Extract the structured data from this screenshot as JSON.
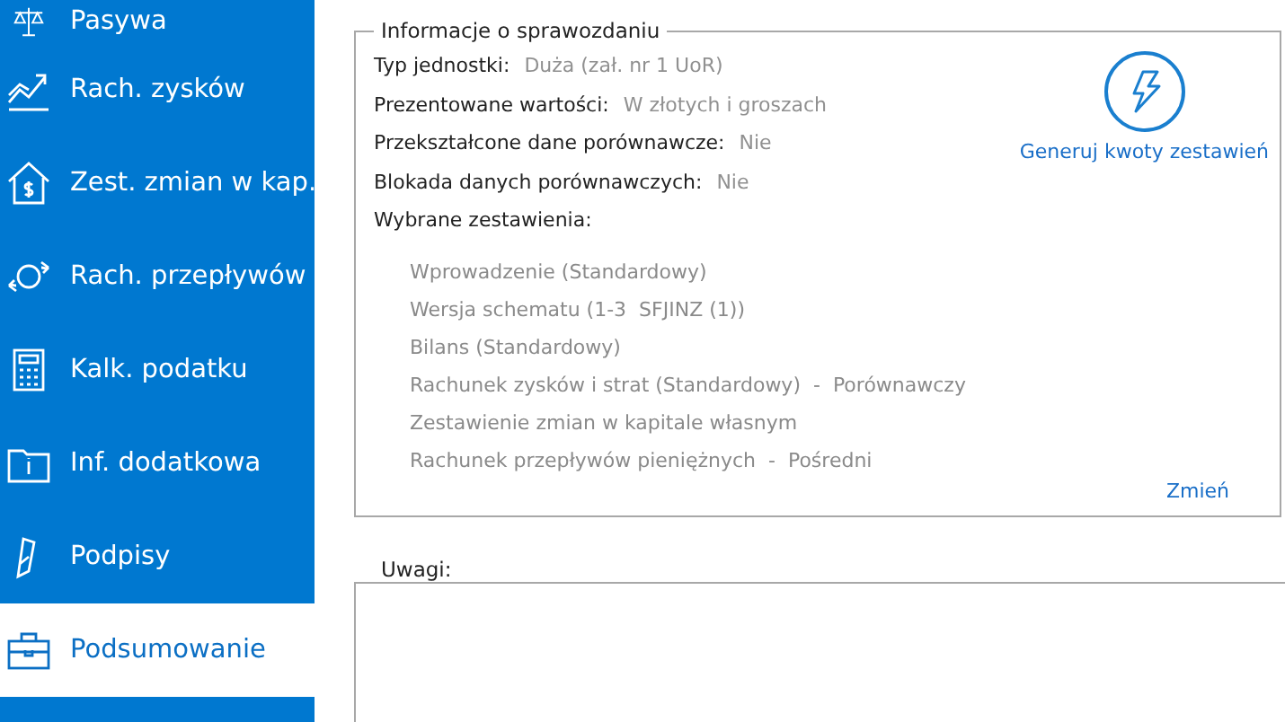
{
  "sidebar": {
    "items": [
      {
        "label": "Pasywa",
        "kind": "scale",
        "selected": false
      },
      {
        "label": "Rach. zysków",
        "kind": "chart",
        "selected": false
      },
      {
        "label": "Zest. zmian w kap.",
        "kind": "house",
        "selected": false
      },
      {
        "label": "Rach. przepływów",
        "kind": "flow",
        "selected": false
      },
      {
        "label": "Kalk. podatku",
        "kind": "calc",
        "selected": false
      },
      {
        "label": "Inf. dodatkowa",
        "kind": "folder",
        "selected": false
      },
      {
        "label": "Podpisy",
        "kind": "pen",
        "selected": false
      },
      {
        "label": "Podsumowanie",
        "kind": "case",
        "selected": true
      }
    ]
  },
  "report_info": {
    "title": "Informacje o sprawozdaniu",
    "fields": [
      {
        "label": "Typ jednostki:",
        "value": "Duża (zał. nr 1 UoR)"
      },
      {
        "label": "Prezentowane wartości:",
        "value": "W złotych i groszach"
      },
      {
        "label": "Przekształcone dane porównawcze:",
        "value": "Nie"
      },
      {
        "label": "Blokada danych porównawczych:",
        "value": "Nie"
      }
    ],
    "selected_label": "Wybrane zestawienia:",
    "selected_statements": [
      "Wprowadzenie (Standardowy)",
      "Wersja schematu (1-3  SFJINZ (1))",
      "Bilans (Standardowy)",
      "Rachunek zysków i strat (Standardowy)  -  Porównawczy",
      "Zestawienie zmian w kapitale własnym",
      "Rachunek przepływów pieniężnych  -  Pośredni"
    ],
    "generate_button": "Generuj kwoty zestawień",
    "change_link": "Zmień"
  },
  "notes": {
    "label": "Uwagi:"
  }
}
